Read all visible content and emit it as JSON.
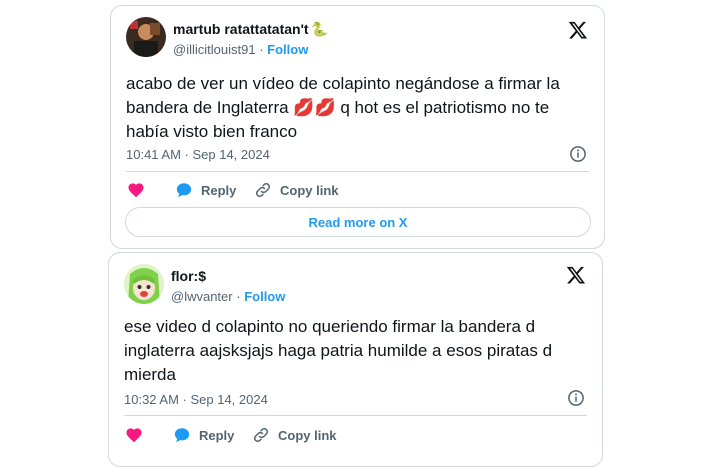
{
  "tweets": [
    {
      "author_name": "martub ratattatatan't",
      "handle": "@illicitlouist91",
      "separator": "·",
      "follow": "Follow",
      "text": "acabo de ver un vídeo de colapinto negándose a firmar la\nbandera de Inglaterra 💋💋 q hot es el patriotismo no te\nhabía visto bien franco",
      "timestamp": "10:41 AM · Sep 14, 2024",
      "reply_label": "Reply",
      "copy_label": "Copy link",
      "read_more": "Read more on X",
      "name_emoji": "🐍"
    },
    {
      "author_name": "flor:$",
      "handle": "@lwvanter",
      "separator": "·",
      "follow": "Follow",
      "text": "ese video d colapinto no queriendo firmar la bandera d\ninglaterra aajsksjajs haga patria humilde a esos piratas d\nmierda",
      "timestamp": "10:32 AM · Sep 14, 2024",
      "reply_label": "Reply",
      "copy_label": "Copy link"
    }
  ],
  "colors": {
    "link_blue": "#1d9bf0",
    "heart_pink": "#f91880",
    "muted_gray": "#536471",
    "border": "#cfd9de"
  },
  "icons": [
    "x-logo-icon",
    "info-icon",
    "heart-icon",
    "reply-icon",
    "link-icon"
  ]
}
